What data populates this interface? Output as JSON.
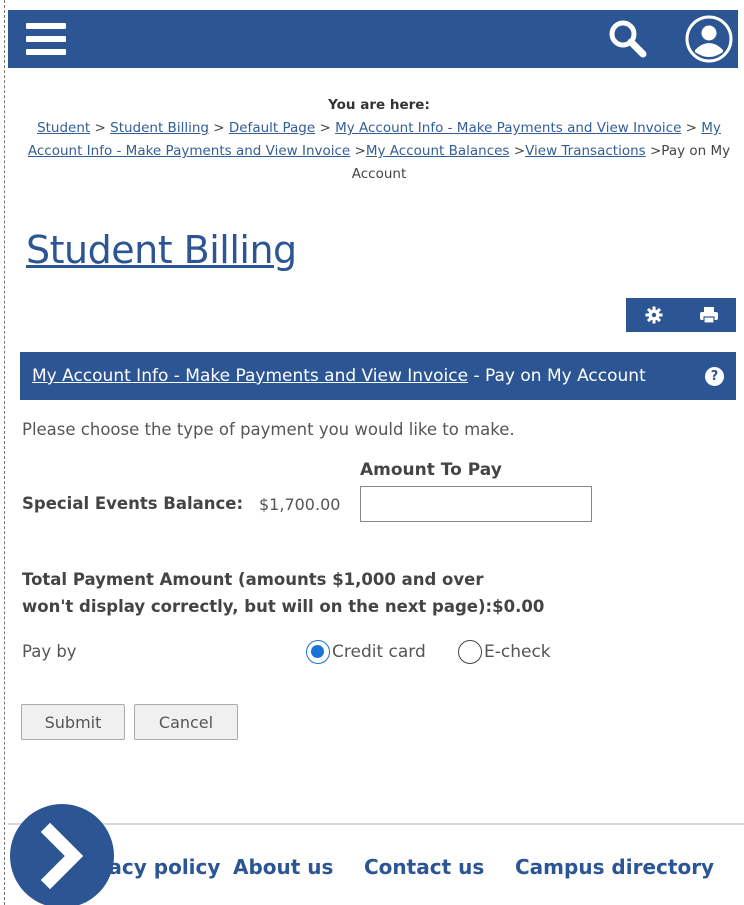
{
  "header": {
    "menu_icon": "hamburger-menu-icon",
    "search_icon": "search-icon",
    "user_icon": "user-account-icon",
    "bar_color": "#2c5593"
  },
  "breadcrumb": {
    "label": "You are here:",
    "items": [
      "Student",
      "Student Billing",
      "Default Page",
      "My Account Info - Make Payments and View Invoice",
      "My Account Info - Make Payments and View Invoice",
      "My Account Balances",
      "View Transactions"
    ],
    "current": "Pay on My Account",
    "separator": ">"
  },
  "page_title": "Student Billing",
  "tools": {
    "settings_icon": "gear-icon",
    "print_icon": "printer-icon"
  },
  "section": {
    "link": "My Account Info - Make Payments and View Invoice",
    "suffix": " - Pay on My Account",
    "help_icon": "help-icon",
    "help_glyph": "?"
  },
  "form": {
    "instructions": "Please choose the type of payment you would like to make.",
    "amount_header": "Amount To Pay",
    "balance_label": "Special Events Balance:",
    "balance_value": "$1,700.00",
    "amount_value": "",
    "total_line1": "Total Payment Amount (amounts $1,000 and over",
    "total_line2": "won't display correctly, but will on the next page):$0.00",
    "pay_by_label": "Pay by",
    "options": [
      {
        "label": "Credit card",
        "selected": true
      },
      {
        "label": "E-check",
        "selected": false
      }
    ],
    "submit_label": "Submit",
    "cancel_label": "Cancel"
  },
  "footer": {
    "links": [
      "Privacy policy",
      "About us",
      "Contact us",
      "Campus directory"
    ],
    "float_icon": "chevron-right-icon"
  }
}
